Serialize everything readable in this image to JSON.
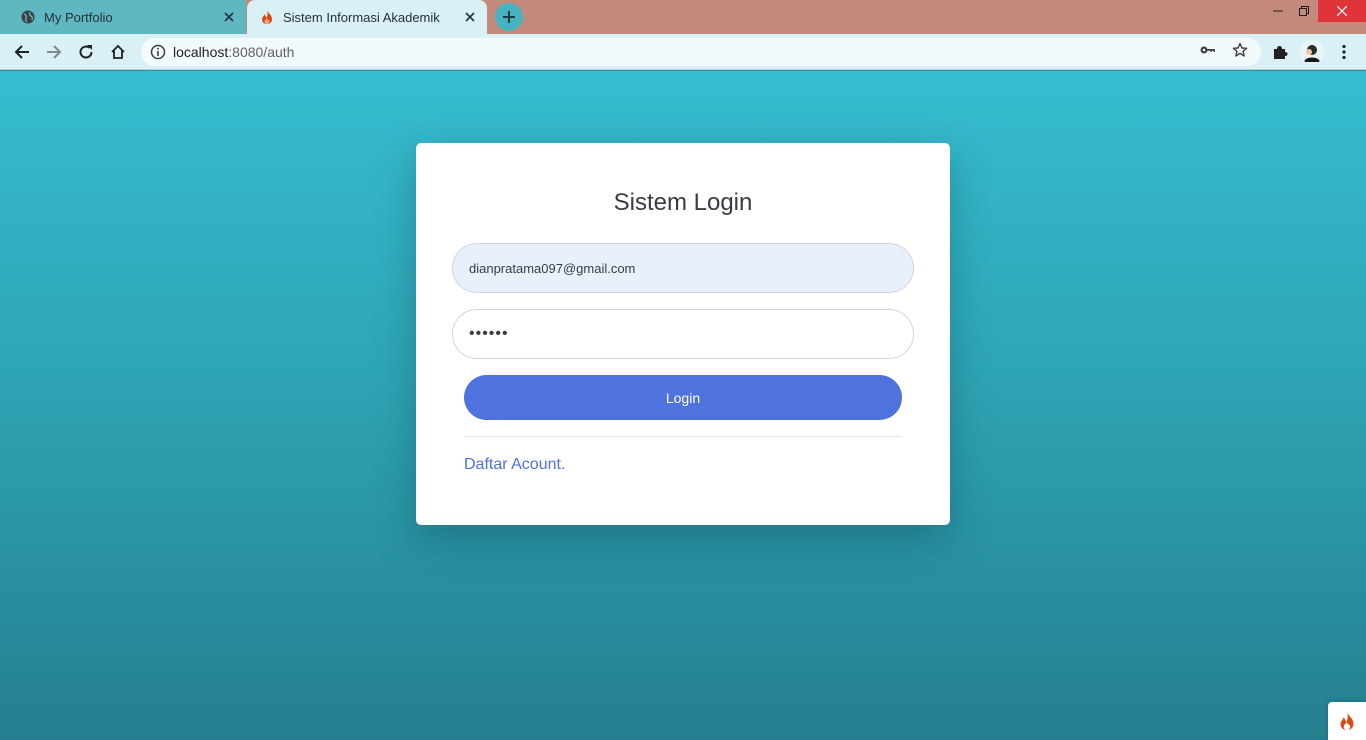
{
  "browser": {
    "tabs": [
      {
        "title": "My Portfolio",
        "icon": "globe-icon",
        "active": false
      },
      {
        "title": "Sistem Informasi Akademik",
        "icon": "codeigniter-flame-icon",
        "active": true
      }
    ],
    "address": {
      "host": "localhost",
      "path": ":8080/auth"
    },
    "colors": {
      "titlebar": "#c38a7b",
      "toolbar": "#d9f0f4",
      "close": "#e0333a"
    }
  },
  "login": {
    "title": "Sistem Login",
    "email_value": "dianpratama097@gmail.com",
    "password_value": "••••••",
    "button_label": "Login",
    "register_link": "Daftar Acount."
  },
  "theme": {
    "accent": "#4e73df",
    "page_gradient": [
      "#36bdd0",
      "#257f8f"
    ]
  }
}
